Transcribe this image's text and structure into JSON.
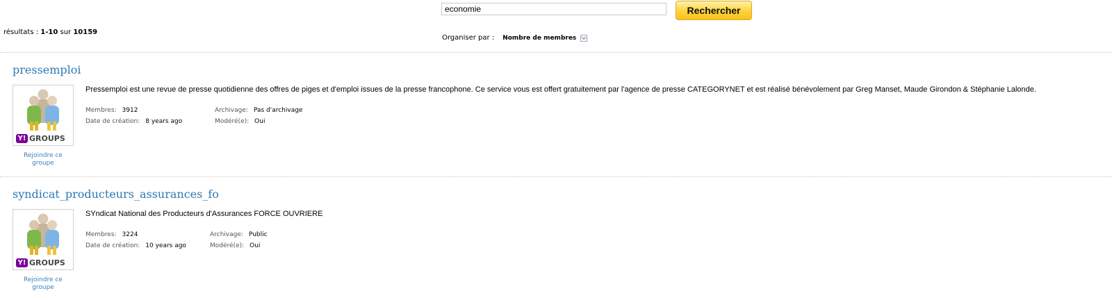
{
  "search": {
    "query": "economie",
    "button_label": "Rechercher"
  },
  "results": {
    "prefix": "résultats : ",
    "range": "1-10",
    "of": " sur ",
    "total": "10159"
  },
  "sort": {
    "label": "Organiser par :",
    "value": "Nombre de membres"
  },
  "logo_text": "GROUPS",
  "groups": [
    {
      "name": "pressemploi",
      "description": "Pressemploi est une revue de presse quotidienne des offres de piges et d'emploi issues de la presse francophone. Ce service vous est offert gratuitement par l'agence de presse CATEGORYNET et est réalisé bénévolement par Greg Manset, Maude Girondon & Stéphanie Lalonde.",
      "members_label": "Membres:",
      "members": "3912",
      "created_label": "Date de création:",
      "created": "8 years ago",
      "archive_label": "Archivage:",
      "archive": "Pas d'archivage",
      "moderated_label": "Modéré(e):",
      "moderated": "Oui",
      "join_label": "Rejoindre ce groupe"
    },
    {
      "name": "syndicat_producteurs_assurances_fo",
      "description": "SYndicat National des Producteurs d'Assurances FORCE OUVRIERE",
      "members_label": "Membres:",
      "members": "3224",
      "created_label": "Date de création:",
      "created": "10 years ago",
      "archive_label": "Archivage:",
      "archive": "Public",
      "moderated_label": "Modéré(e):",
      "moderated": "Oui",
      "join_label": "Rejoindre ce groupe"
    }
  ]
}
